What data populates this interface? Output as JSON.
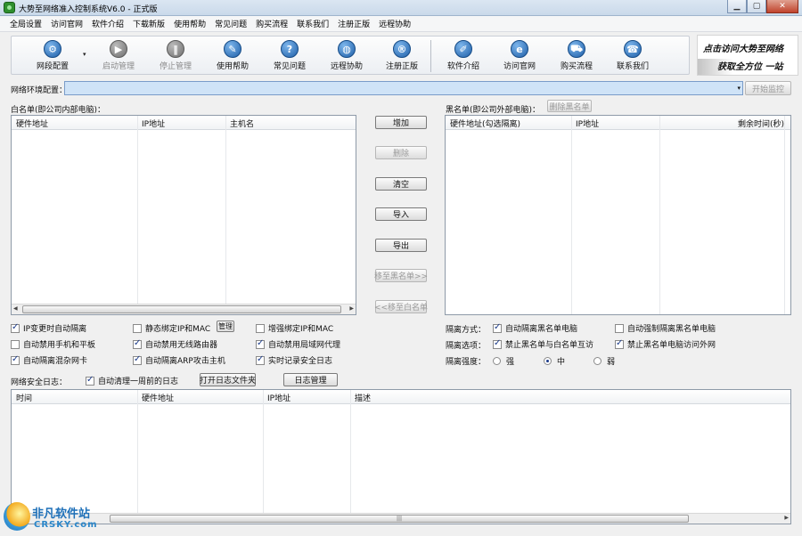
{
  "window": {
    "title": "大势至网络准入控制系统V6.0 - 正式版",
    "min": "▁",
    "max": "▢",
    "close": "✕"
  },
  "menu": [
    "全局设置",
    "访问官网",
    "软件介绍",
    "下载新版",
    "使用帮助",
    "常见问题",
    "购买流程",
    "联系我们",
    "注册正版",
    "远程协助"
  ],
  "toolbar": {
    "dropdown_arrow": "▾",
    "items": [
      {
        "label": "网段配置",
        "icon": "gear-icon",
        "glyph": "⚙",
        "enabled": true
      },
      {
        "label": "启动管理",
        "icon": "play-icon",
        "glyph": "▶",
        "enabled": false
      },
      {
        "label": "停止管理",
        "icon": "pause-icon",
        "glyph": "‖",
        "enabled": false
      },
      {
        "label": "使用帮助",
        "icon": "grad-cap-icon",
        "glyph": "✎",
        "enabled": true
      },
      {
        "label": "常见问题",
        "icon": "question-icon",
        "glyph": "?",
        "enabled": true
      },
      {
        "label": "远程协助",
        "icon": "globe-icon",
        "glyph": "◍",
        "enabled": true
      },
      {
        "label": "注册正版",
        "icon": "registered-icon",
        "glyph": "®",
        "enabled": true
      },
      {
        "label": "软件介绍",
        "icon": "pen-icon",
        "glyph": "✐",
        "enabled": true
      },
      {
        "label": "访问官网",
        "icon": "ie-icon",
        "glyph": "e",
        "enabled": true
      },
      {
        "label": "购买流程",
        "icon": "cart-icon",
        "glyph": "⛟",
        "enabled": true
      },
      {
        "label": "联系我们",
        "icon": "phone-icon",
        "glyph": "☎",
        "enabled": true
      }
    ]
  },
  "banner": {
    "line1": "点击访问大势至网络",
    "line2": "获取全方位 一站"
  },
  "net_env": {
    "label": "网络环境配置：",
    "value": "",
    "dropdown_arrow": "▾",
    "start_button": "开始监控"
  },
  "whitelist": {
    "title": "白名单(即公司内部电脑)：",
    "columns": [
      "硬件地址",
      "IP地址",
      "主机名"
    ]
  },
  "middle_buttons": [
    {
      "label": "增加",
      "enabled": true
    },
    {
      "label": "删除",
      "enabled": false
    },
    {
      "label": "清空",
      "enabled": true
    },
    {
      "label": "导入",
      "enabled": true
    },
    {
      "label": "导出",
      "enabled": true
    },
    {
      "label": "移至黑名单>>",
      "enabled": false
    },
    {
      "label": "<<移至白名单",
      "enabled": false
    }
  ],
  "blacklist": {
    "title": "黑名单(即公司外部电脑)：",
    "delete_button": "删除黑名单",
    "columns": [
      "硬件地址(勾选隔离)",
      "IP地址",
      "剩余时间(秒)"
    ]
  },
  "options": {
    "ip_change_isolate": {
      "label": "IP变更时自动隔离",
      "checked": true
    },
    "static_bind": {
      "label": "静态绑定IP和MAC",
      "checked": false
    },
    "manage_button": "管理",
    "enhanced_bind": {
      "label": "增强绑定IP和MAC",
      "checked": false
    },
    "disable_mobile": {
      "label": "自动禁用手机和平板",
      "checked": false
    },
    "disable_wireless": {
      "label": "自动禁用无线路由器",
      "checked": true
    },
    "disable_lan_proxy": {
      "label": "自动禁用局域网代理",
      "checked": true
    },
    "isolate_promisc": {
      "label": "自动隔离混杂网卡",
      "checked": true
    },
    "isolate_arp": {
      "label": "自动隔离ARP攻击主机",
      "checked": true
    },
    "realtime_log": {
      "label": "实时记录安全日志",
      "checked": true
    }
  },
  "isolation": {
    "mode_label": "隔离方式：",
    "mode_auto": {
      "label": "自动隔离黑名单电脑",
      "checked": true
    },
    "mode_force": {
      "label": "自动强制隔离黑名单电脑",
      "checked": false
    },
    "options_label": "隔离选项：",
    "no_mutual": {
      "label": "禁止黑名单与白名单互访",
      "checked": true
    },
    "no_external": {
      "label": "禁止黑名单电脑访问外网",
      "checked": true
    },
    "strength_label": "隔离强度：",
    "strength": [
      {
        "label": "强",
        "selected": false
      },
      {
        "label": "中",
        "selected": true
      },
      {
        "label": "弱",
        "selected": false
      }
    ]
  },
  "log": {
    "title": "网络安全日志：",
    "auto_clean": {
      "label": "自动清理一周前的日志",
      "checked": true
    },
    "open_folder_button": "打开日志文件夹",
    "manage_button": "日志管理",
    "columns": [
      "时间",
      "硬件地址",
      "IP地址",
      "描述"
    ]
  },
  "scroll": {
    "left_arrow": "◀",
    "right_arrow": "▶",
    "grip": "|||"
  },
  "watermark": {
    "cn": "非凡软件站",
    "en": "CRSKY.com"
  }
}
